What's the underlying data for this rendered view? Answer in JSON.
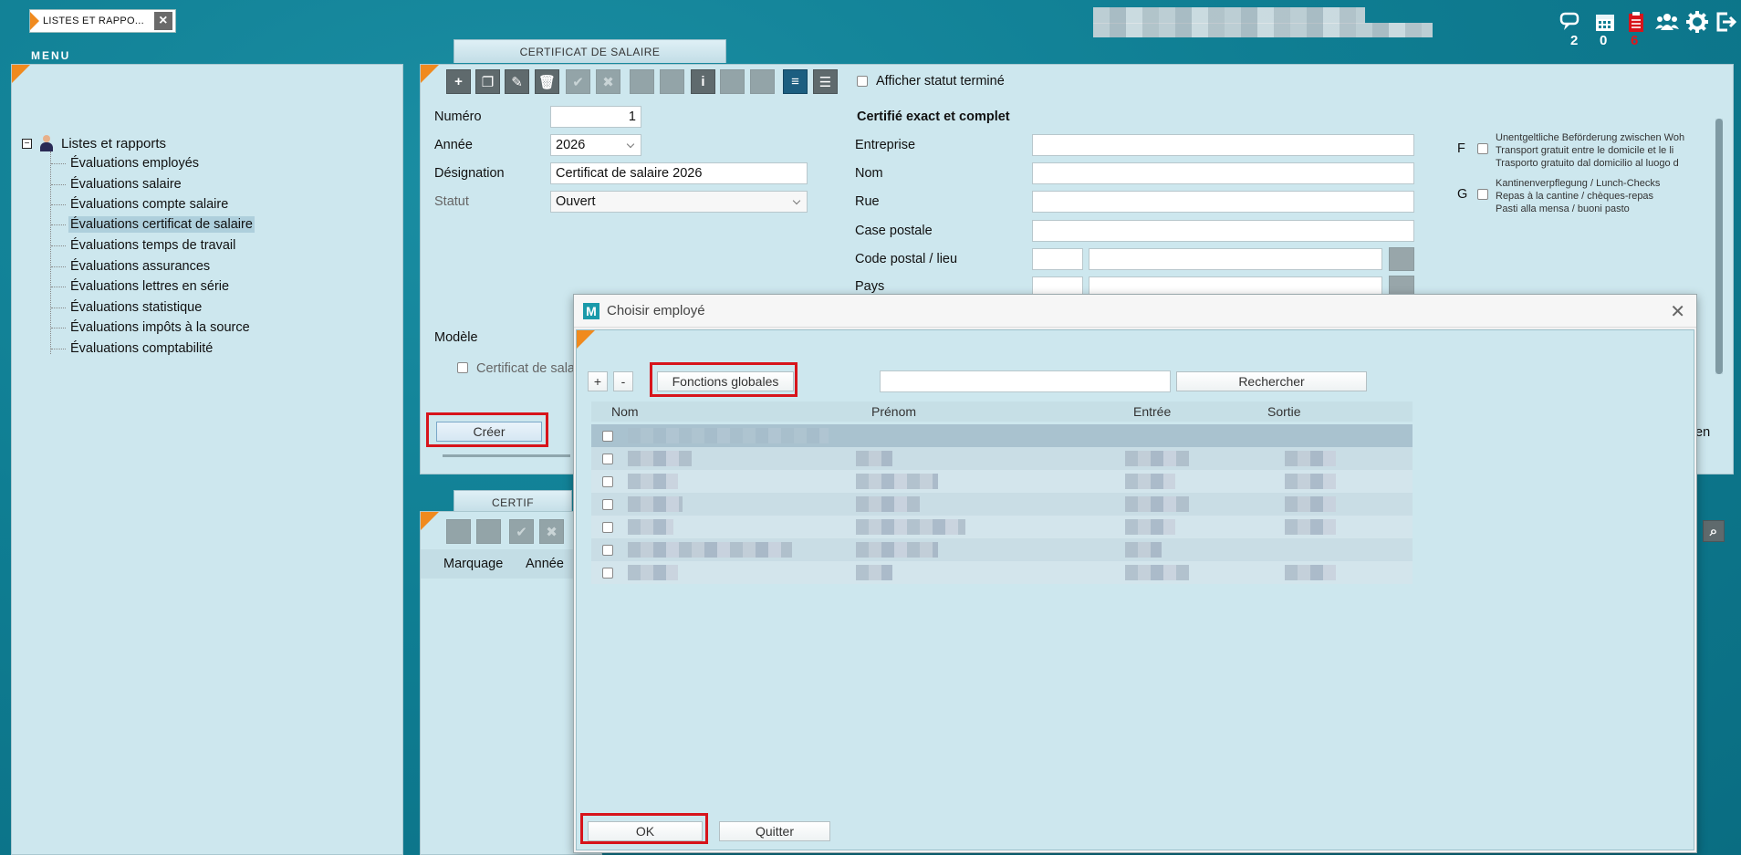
{
  "app": {
    "tab_label": "LISTES ET RAPPO...",
    "menu_title": "MENU",
    "notifications": [
      {
        "icon": "chat-icon",
        "count": "2"
      },
      {
        "icon": "calendar-icon",
        "count": "0"
      },
      {
        "icon": "clipboard-icon",
        "count": "6"
      },
      {
        "icon": "users-icon",
        "count": ""
      },
      {
        "icon": "gear-icon",
        "count": ""
      },
      {
        "icon": "logout-icon",
        "count": ""
      }
    ]
  },
  "sidebar": {
    "root_label": "Listes et rapports",
    "items": [
      {
        "label": "Évaluations employés"
      },
      {
        "label": "Évaluations salaire"
      },
      {
        "label": "Évaluations compte salaire"
      },
      {
        "label": "Évaluations certificat de salaire",
        "selected": true
      },
      {
        "label": "Évaluations temps de travail"
      },
      {
        "label": "Évaluations assurances"
      },
      {
        "label": "Évaluations lettres en série"
      },
      {
        "label": "Évaluations statistique"
      },
      {
        "label": "Évaluations impôts à la source"
      },
      {
        "label": "Évaluations comptabilité"
      }
    ]
  },
  "certificate": {
    "tab_label": "CERTIFICAT DE SALAIRE",
    "show_finished_label": "Afficher statut terminé",
    "fields": {
      "numero_label": "Numéro",
      "numero_value": "1",
      "annee_label": "Année",
      "annee_value": "2026",
      "designation_label": "Désignation",
      "designation_value": "Certificat de salaire 2026",
      "statut_label": "Statut",
      "statut_value": "Ouvert",
      "modele_label": "Modèle",
      "modele_checkbox_label": "Certificat de sala"
    },
    "certified": {
      "heading": "Certifié exact et complet",
      "entreprise_label": "Entreprise",
      "nom_label": "Nom",
      "rue_label": "Rue",
      "case_postale_label": "Case postale",
      "code_postal_label": "Code postal / lieu",
      "pays_label": "Pays"
    },
    "options": {
      "f_letter": "F",
      "f_lines": [
        "Unentgeltliche Beförderung zwischen Woh",
        "Transport gratuit entre le domicile et le li",
        "Trasporto gratuito dal domicilio al luogo d"
      ],
      "g_letter": "G",
      "g_lines": [
        "Kantinenverpflegung / Lunch-Checks",
        "Repas à la cantine / chèques-repas",
        "Pasti alla mensa / buoni pasto"
      ]
    },
    "create_button": "Créer",
    "right_fragment": "en"
  },
  "lower_panel": {
    "tab_label": "CERTIF",
    "col_marquage": "Marquage",
    "col_annee": "Année"
  },
  "modal": {
    "title": "Choisir employé",
    "plus_label": "+",
    "minus_label": "-",
    "global_functions_label": "Fonctions globales",
    "search_value": "",
    "search_button": "Rechercher",
    "columns": {
      "nom": "Nom",
      "prenom": "Prénom",
      "entree": "Entrée",
      "sortie": "Sortie"
    },
    "row_count": 7,
    "ok_button": "OK",
    "quit_button": "Quitter"
  },
  "colors": {
    "accent_orange": "#f08a1e",
    "highlight_red": "#d7141b",
    "background_teal": "#0f7e93",
    "panel_bg": "#cde7ee"
  }
}
